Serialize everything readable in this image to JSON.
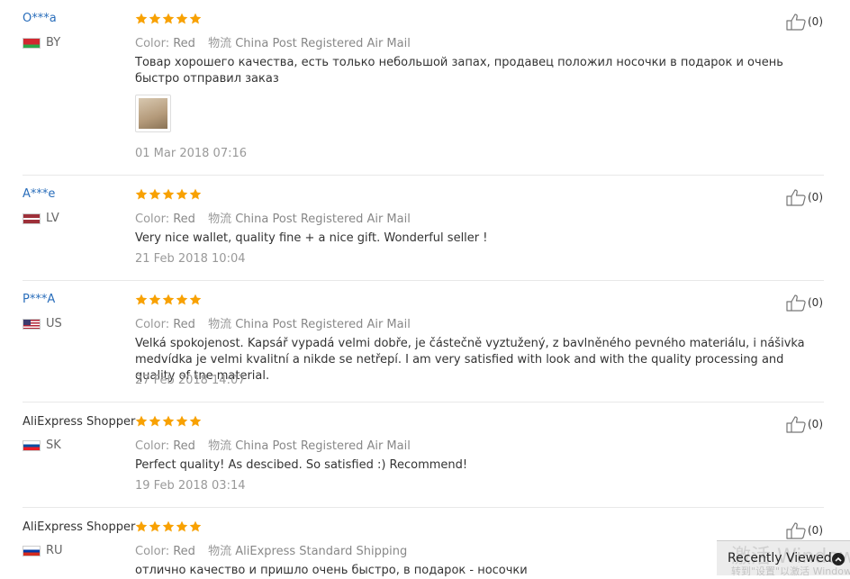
{
  "reviews": [
    {
      "user": "O***a",
      "masked": true,
      "country": "BY",
      "rating": 5,
      "color_label": "Color:",
      "color_value": "Red",
      "shipping_label": "物流",
      "shipping_value": "China Post Registered Air Mail",
      "text": "Товар хорошего качества, есть только небольшой запах, продавец положил носочки в подарок и очень быстро отправил заказ",
      "has_photo": true,
      "date": "01 Mar 2018 07:16",
      "likes": "(0)"
    },
    {
      "user": "A***e",
      "masked": true,
      "country": "LV",
      "rating": 5,
      "color_label": "Color:",
      "color_value": "Red",
      "shipping_label": "物流",
      "shipping_value": "China Post Registered Air Mail",
      "text": "Very nice wallet, quality fine + a nice gift. Wonderful seller !",
      "has_photo": false,
      "date": "21 Feb 2018 10:04",
      "likes": "(0)"
    },
    {
      "user": "P***A",
      "masked": true,
      "country": "US",
      "rating": 5,
      "color_label": "Color:",
      "color_value": "Red",
      "shipping_label": "物流",
      "shipping_value": "China Post Registered Air Mail",
      "text": "Velká spokojenost. Kapsář vypadá velmi dobře, je částečně vyztužený, z bavlněného pevného materiálu, i nášivka medvídka je velmi kvalitní a nikde se netřepí. I am very satisfied with look and with the quality processing and quality of tne material.",
      "has_photo": false,
      "date": "27 Feb 2018 14:07",
      "likes": "(0)"
    },
    {
      "user": "AliExpress Shopper",
      "masked": false,
      "country": "SK",
      "rating": 5,
      "color_label": "Color:",
      "color_value": "Red",
      "shipping_label": "物流",
      "shipping_value": "China Post Registered Air Mail",
      "text": "Perfect quality! As descibed. So satisfied :) Recommend!",
      "has_photo": false,
      "date": "19 Feb 2018 03:14",
      "likes": "(0)"
    },
    {
      "user": "AliExpress Shopper",
      "masked": false,
      "country": "RU",
      "rating": 5,
      "color_label": "Color:",
      "color_value": "Red",
      "shipping_label": "物流",
      "shipping_value": "AliExpress Standard Shipping",
      "text": "отлично качество и пришло очень быстро, в подарок - носочки",
      "has_photo": false,
      "date": "",
      "likes": "(0)"
    }
  ],
  "icons": {
    "star": "star-icon",
    "like": "thumbs-up-icon",
    "collapse": "chevron-up-icon"
  },
  "colors": {
    "star": "#f8a102",
    "user_link": "#2a6ebb"
  },
  "recently_viewed": {
    "label": "Recently Viewed"
  },
  "watermark": {
    "line1": "激活 Windows",
    "line2": "转到\"设置\"以激活 Windows。"
  }
}
